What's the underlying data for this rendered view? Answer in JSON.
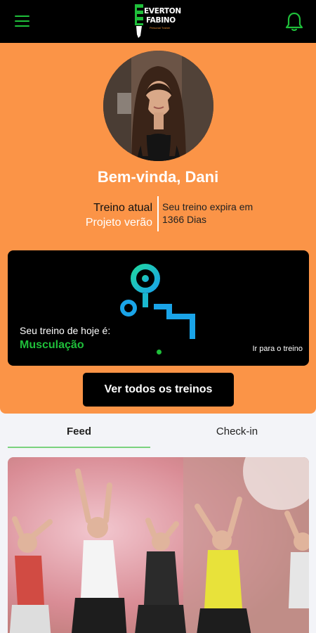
{
  "header": {
    "logo": {
      "line1": "EVERTON",
      "line2": "FABINO",
      "tagline": "Personal Trainer"
    },
    "menu_icon": "hamburger-menu-icon",
    "bell_icon": "bell-icon"
  },
  "colors": {
    "accent_green": "#1fbf3a",
    "hero_orange": "#fb9447",
    "black": "#000000"
  },
  "profile": {
    "welcome": "Bem-vinda, Dani",
    "training_label": "Treino atual",
    "training_name": "Projeto verão",
    "expiry_line1": "Seu treino expira em",
    "expiry_line2": "1366 Dias"
  },
  "today_card": {
    "label": "Seu treino de hoje é:",
    "value": "Musculação",
    "link": "Ir para o treino",
    "icon": "weightlifting-bench-icon"
  },
  "all_workouts_button": "Ver todos os treinos",
  "tabs": [
    {
      "label": "Feed",
      "active": true
    },
    {
      "label": "Check-in",
      "active": false
    }
  ]
}
